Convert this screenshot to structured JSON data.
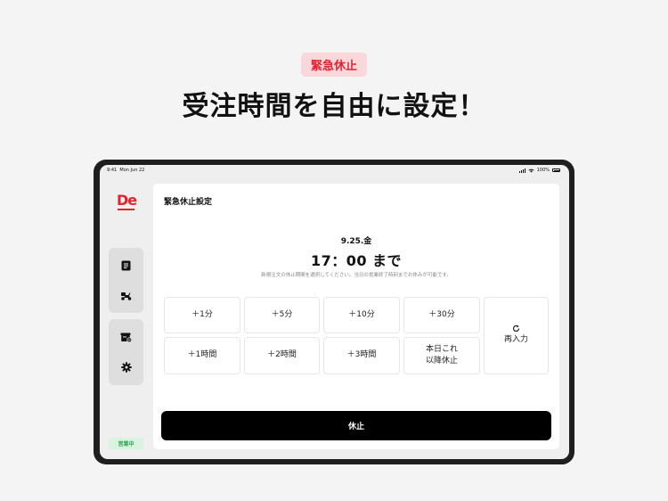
{
  "promo": {
    "badge": "緊急休止",
    "headline": "受注時間を自由に設定！"
  },
  "status_bar": {
    "time": "9:41",
    "date": "Mon Jun 22",
    "battery": "100%"
  },
  "sidebar": {
    "logo": "De",
    "items": [
      {
        "icon": "orders-icon"
      },
      {
        "icon": "delivery-scooter-icon"
      },
      {
        "icon": "store-closed-icon"
      },
      {
        "icon": "gear-icon"
      }
    ],
    "status_label": "営業中"
  },
  "panel": {
    "title": "緊急休止設定",
    "date": "9.25.金",
    "until": "17：00 まで",
    "hint": "新規注文の休止期間を選択してください。当日の営業終了時刻までお休みが可能です。",
    "buttons": {
      "plus_1min": "＋1分",
      "plus_5min": "＋5分",
      "plus_10min": "＋10分",
      "plus_30min": "＋30分",
      "plus_1hour": "＋1時間",
      "plus_2hour": "＋2時間",
      "plus_3hour": "＋3時間",
      "rest_of_day_line1": "本日これ",
      "rest_of_day_line2": "以降休止",
      "reset": "再入力"
    },
    "pause_button": "休止"
  },
  "colors": {
    "accent": "#e2232f",
    "badge_bg": "#f9d7da",
    "status_green": "#2fa44f",
    "background": "#f4f4f4"
  }
}
